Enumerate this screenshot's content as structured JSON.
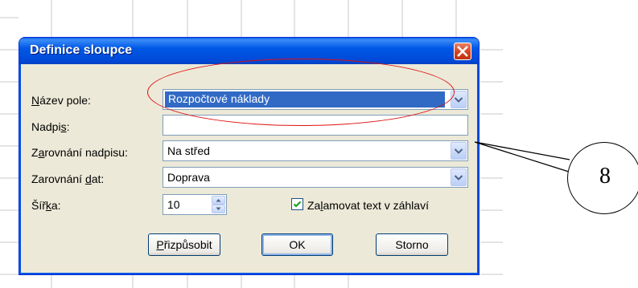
{
  "dialog": {
    "title": "Definice sloupce",
    "fields": {
      "nazev_pole": {
        "label_pre": "",
        "label_key": "N",
        "label_post": "ázev pole:",
        "value": "Rozpočtové náklady"
      },
      "nadpis": {
        "label_pre": "Nadpi",
        "label_key": "s",
        "label_post": ":",
        "value": ""
      },
      "zarovnani_nadpisu": {
        "label_pre": "Z",
        "label_key": "a",
        "label_post": "rovnání nadpisu:",
        "value": "Na střed"
      },
      "zarovnani_dat": {
        "label_pre": "Zarovnání ",
        "label_key": "d",
        "label_post": "at:",
        "value": "Doprava"
      },
      "sirka": {
        "label_pre": "Šíř",
        "label_key": "k",
        "label_post": "a:",
        "value": "10"
      }
    },
    "wrap_checkbox": {
      "checked": true,
      "label_pre": "Za",
      "label_key": "l",
      "label_post": "amovat text v záhlaví"
    },
    "buttons": {
      "prizpusobit": {
        "label_pre": "",
        "label_key": "P",
        "label_post": "řizpůsobit"
      },
      "ok": "OK",
      "storno": "Storno"
    }
  },
  "annotation": {
    "callout_number": "8",
    "highlight_color": "#e01010"
  },
  "colors": {
    "titlebar": "#0058e6",
    "selection": "#316ac5",
    "dialog_bg": "#ece9d8"
  }
}
